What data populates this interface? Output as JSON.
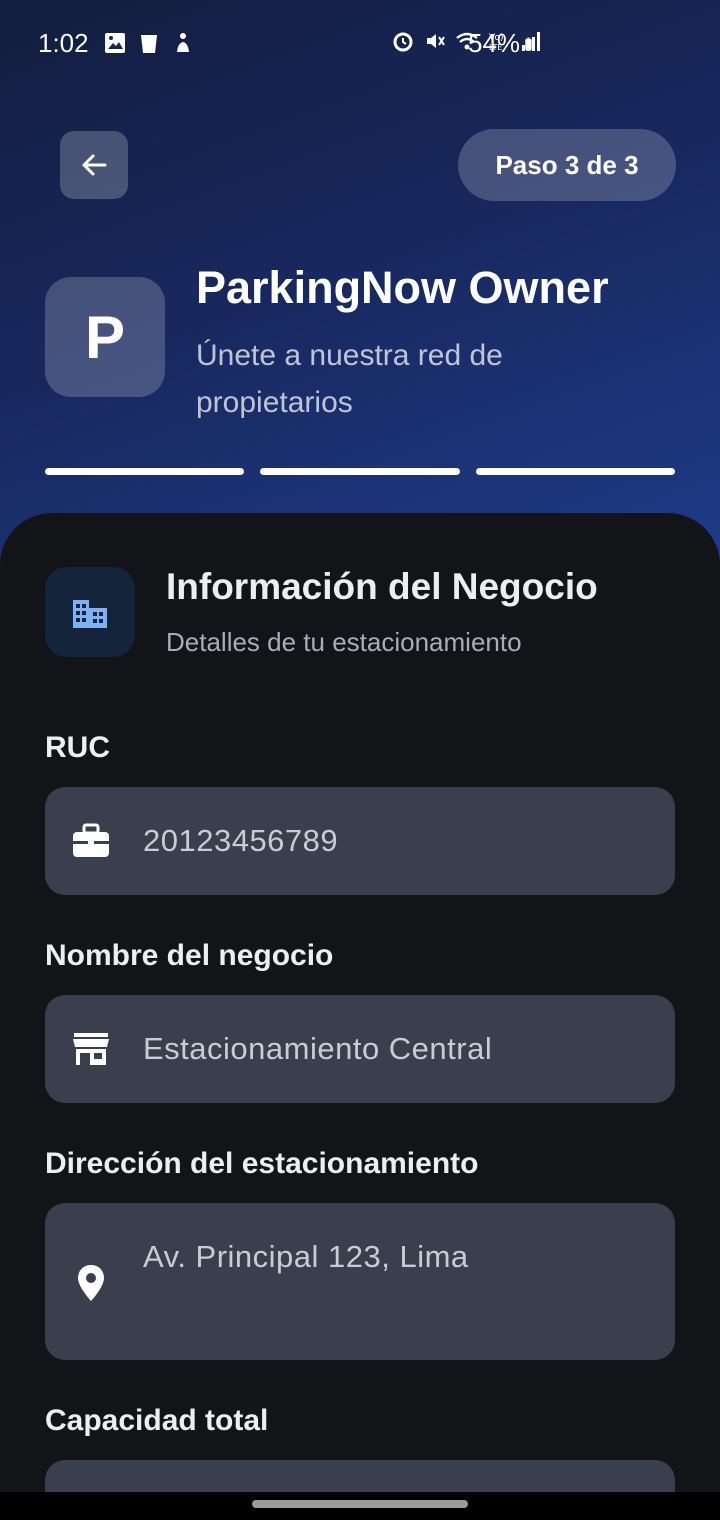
{
  "status_bar": {
    "time": "1:02",
    "battery": "54%",
    "left_icons": [
      "image-icon",
      "trash-icon",
      "accessibility-icon"
    ],
    "right_icons": [
      "alarm-icon",
      "mute-icon",
      "wifi-icon",
      "volte-icon",
      "signal-icon",
      "battery-icon"
    ]
  },
  "header": {
    "step_label": "Paso 3 de 3",
    "logo_letter": "P",
    "app_title": "ParkingNow Owner",
    "app_subtitle": "Únete a nuestra red de propietarios",
    "progress": {
      "completed_steps": 3,
      "total_steps": 3
    }
  },
  "section": {
    "title": "Información del Negocio",
    "subtitle": "Detalles de tu estacionamiento",
    "icon": "building-icon"
  },
  "form": {
    "ruc": {
      "label": "RUC",
      "value": "20123456789",
      "icon": "briefcase-icon"
    },
    "business_name": {
      "label": "Nombre del negocio",
      "value": "Estacionamiento Central",
      "icon": "store-icon"
    },
    "address": {
      "label": "Dirección del estacionamiento",
      "value": "Av. Principal 123, Lima",
      "icon": "location-pin-icon"
    },
    "capacity": {
      "label": "Capacidad total",
      "value": ""
    }
  },
  "colors": {
    "hero_gradient_start": "#131d3f",
    "hero_gradient_end": "#1e3d8d",
    "sheet_background": "#131418",
    "field_background": "#393f4d",
    "accent_icon": "#7fb2f5"
  }
}
